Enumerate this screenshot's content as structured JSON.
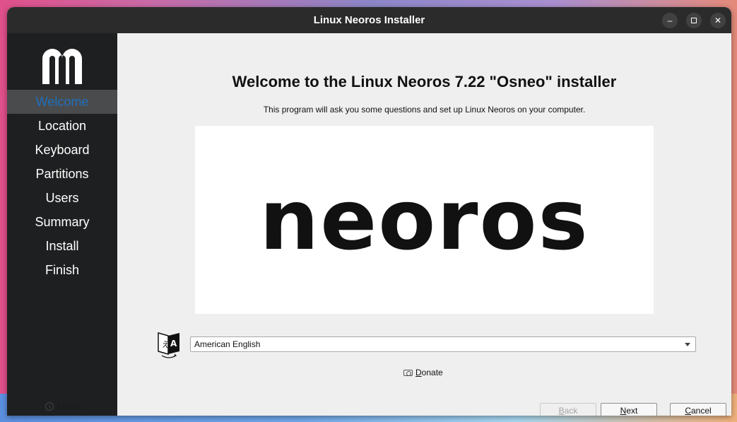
{
  "window": {
    "title": "Linux Neoros Installer"
  },
  "sidebar": {
    "logo_icon": "neoros-m-logo-icon",
    "items": [
      {
        "label": "Welcome",
        "active": true
      },
      {
        "label": "Location",
        "active": false
      },
      {
        "label": "Keyboard",
        "active": false
      },
      {
        "label": "Partitions",
        "active": false
      },
      {
        "label": "Users",
        "active": false
      },
      {
        "label": "Summary",
        "active": false
      },
      {
        "label": "Install",
        "active": false
      },
      {
        "label": "Finish",
        "active": false
      }
    ],
    "about_label": "About"
  },
  "main": {
    "heading": "Welcome to the Linux Neoros 7.22 \"Osneo\" installer",
    "subheading": "This program will ask you some questions and set up Linux Neoros on your computer.",
    "banner_text": "neoros",
    "language": {
      "selected": "American English",
      "icon": "language-translate-icon"
    },
    "donate": {
      "label_first": "D",
      "label_rest": "onate"
    }
  },
  "buttons": {
    "back": {
      "first": "B",
      "rest": "ack"
    },
    "next": {
      "first": "N",
      "rest": "ext"
    },
    "cancel": {
      "first": "C",
      "rest": "ancel"
    }
  },
  "colors": {
    "active_nav_text": "#1f6fbf",
    "sidebar_bg": "#1e1f20",
    "titlebar_bg": "#2b2b2b"
  }
}
